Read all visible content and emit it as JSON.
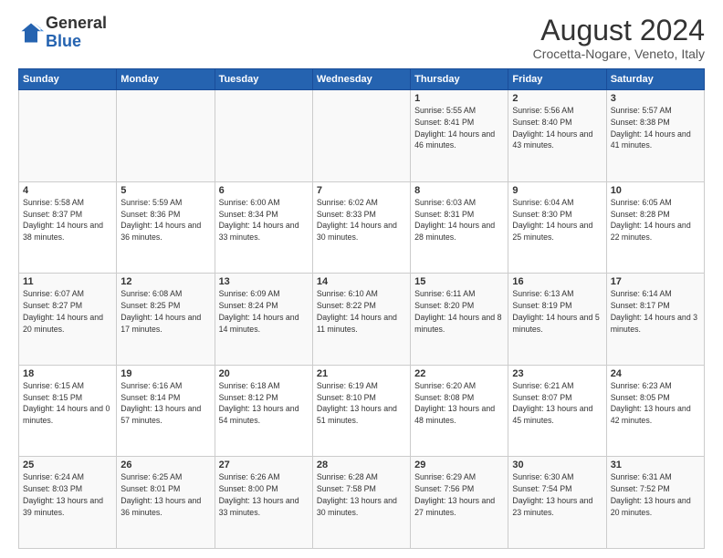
{
  "header": {
    "logo": {
      "general": "General",
      "blue": "Blue"
    },
    "month_year": "August 2024",
    "location": "Crocetta-Nogare, Veneto, Italy"
  },
  "calendar": {
    "weekdays": [
      "Sunday",
      "Monday",
      "Tuesday",
      "Wednesday",
      "Thursday",
      "Friday",
      "Saturday"
    ],
    "weeks": [
      [
        {
          "day": "",
          "sunrise": "",
          "sunset": "",
          "daylight": ""
        },
        {
          "day": "",
          "sunrise": "",
          "sunset": "",
          "daylight": ""
        },
        {
          "day": "",
          "sunrise": "",
          "sunset": "",
          "daylight": ""
        },
        {
          "day": "",
          "sunrise": "",
          "sunset": "",
          "daylight": ""
        },
        {
          "day": "1",
          "sunrise": "Sunrise: 5:55 AM",
          "sunset": "Sunset: 8:41 PM",
          "daylight": "Daylight: 14 hours and 46 minutes."
        },
        {
          "day": "2",
          "sunrise": "Sunrise: 5:56 AM",
          "sunset": "Sunset: 8:40 PM",
          "daylight": "Daylight: 14 hours and 43 minutes."
        },
        {
          "day": "3",
          "sunrise": "Sunrise: 5:57 AM",
          "sunset": "Sunset: 8:38 PM",
          "daylight": "Daylight: 14 hours and 41 minutes."
        }
      ],
      [
        {
          "day": "4",
          "sunrise": "Sunrise: 5:58 AM",
          "sunset": "Sunset: 8:37 PM",
          "daylight": "Daylight: 14 hours and 38 minutes."
        },
        {
          "day": "5",
          "sunrise": "Sunrise: 5:59 AM",
          "sunset": "Sunset: 8:36 PM",
          "daylight": "Daylight: 14 hours and 36 minutes."
        },
        {
          "day": "6",
          "sunrise": "Sunrise: 6:00 AM",
          "sunset": "Sunset: 8:34 PM",
          "daylight": "Daylight: 14 hours and 33 minutes."
        },
        {
          "day": "7",
          "sunrise": "Sunrise: 6:02 AM",
          "sunset": "Sunset: 8:33 PM",
          "daylight": "Daylight: 14 hours and 30 minutes."
        },
        {
          "day": "8",
          "sunrise": "Sunrise: 6:03 AM",
          "sunset": "Sunset: 8:31 PM",
          "daylight": "Daylight: 14 hours and 28 minutes."
        },
        {
          "day": "9",
          "sunrise": "Sunrise: 6:04 AM",
          "sunset": "Sunset: 8:30 PM",
          "daylight": "Daylight: 14 hours and 25 minutes."
        },
        {
          "day": "10",
          "sunrise": "Sunrise: 6:05 AM",
          "sunset": "Sunset: 8:28 PM",
          "daylight": "Daylight: 14 hours and 22 minutes."
        }
      ],
      [
        {
          "day": "11",
          "sunrise": "Sunrise: 6:07 AM",
          "sunset": "Sunset: 8:27 PM",
          "daylight": "Daylight: 14 hours and 20 minutes."
        },
        {
          "day": "12",
          "sunrise": "Sunrise: 6:08 AM",
          "sunset": "Sunset: 8:25 PM",
          "daylight": "Daylight: 14 hours and 17 minutes."
        },
        {
          "day": "13",
          "sunrise": "Sunrise: 6:09 AM",
          "sunset": "Sunset: 8:24 PM",
          "daylight": "Daylight: 14 hours and 14 minutes."
        },
        {
          "day": "14",
          "sunrise": "Sunrise: 6:10 AM",
          "sunset": "Sunset: 8:22 PM",
          "daylight": "Daylight: 14 hours and 11 minutes."
        },
        {
          "day": "15",
          "sunrise": "Sunrise: 6:11 AM",
          "sunset": "Sunset: 8:20 PM",
          "daylight": "Daylight: 14 hours and 8 minutes."
        },
        {
          "day": "16",
          "sunrise": "Sunrise: 6:13 AM",
          "sunset": "Sunset: 8:19 PM",
          "daylight": "Daylight: 14 hours and 5 minutes."
        },
        {
          "day": "17",
          "sunrise": "Sunrise: 6:14 AM",
          "sunset": "Sunset: 8:17 PM",
          "daylight": "Daylight: 14 hours and 3 minutes."
        }
      ],
      [
        {
          "day": "18",
          "sunrise": "Sunrise: 6:15 AM",
          "sunset": "Sunset: 8:15 PM",
          "daylight": "Daylight: 14 hours and 0 minutes."
        },
        {
          "day": "19",
          "sunrise": "Sunrise: 6:16 AM",
          "sunset": "Sunset: 8:14 PM",
          "daylight": "Daylight: 13 hours and 57 minutes."
        },
        {
          "day": "20",
          "sunrise": "Sunrise: 6:18 AM",
          "sunset": "Sunset: 8:12 PM",
          "daylight": "Daylight: 13 hours and 54 minutes."
        },
        {
          "day": "21",
          "sunrise": "Sunrise: 6:19 AM",
          "sunset": "Sunset: 8:10 PM",
          "daylight": "Daylight: 13 hours and 51 minutes."
        },
        {
          "day": "22",
          "sunrise": "Sunrise: 6:20 AM",
          "sunset": "Sunset: 8:08 PM",
          "daylight": "Daylight: 13 hours and 48 minutes."
        },
        {
          "day": "23",
          "sunrise": "Sunrise: 6:21 AM",
          "sunset": "Sunset: 8:07 PM",
          "daylight": "Daylight: 13 hours and 45 minutes."
        },
        {
          "day": "24",
          "sunrise": "Sunrise: 6:23 AM",
          "sunset": "Sunset: 8:05 PM",
          "daylight": "Daylight: 13 hours and 42 minutes."
        }
      ],
      [
        {
          "day": "25",
          "sunrise": "Sunrise: 6:24 AM",
          "sunset": "Sunset: 8:03 PM",
          "daylight": "Daylight: 13 hours and 39 minutes."
        },
        {
          "day": "26",
          "sunrise": "Sunrise: 6:25 AM",
          "sunset": "Sunset: 8:01 PM",
          "daylight": "Daylight: 13 hours and 36 minutes."
        },
        {
          "day": "27",
          "sunrise": "Sunrise: 6:26 AM",
          "sunset": "Sunset: 8:00 PM",
          "daylight": "Daylight: 13 hours and 33 minutes."
        },
        {
          "day": "28",
          "sunrise": "Sunrise: 6:28 AM",
          "sunset": "Sunset: 7:58 PM",
          "daylight": "Daylight: 13 hours and 30 minutes."
        },
        {
          "day": "29",
          "sunrise": "Sunrise: 6:29 AM",
          "sunset": "Sunset: 7:56 PM",
          "daylight": "Daylight: 13 hours and 27 minutes."
        },
        {
          "day": "30",
          "sunrise": "Sunrise: 6:30 AM",
          "sunset": "Sunset: 7:54 PM",
          "daylight": "Daylight: 13 hours and 23 minutes."
        },
        {
          "day": "31",
          "sunrise": "Sunrise: 6:31 AM",
          "sunset": "Sunset: 7:52 PM",
          "daylight": "Daylight: 13 hours and 20 minutes."
        }
      ]
    ]
  }
}
